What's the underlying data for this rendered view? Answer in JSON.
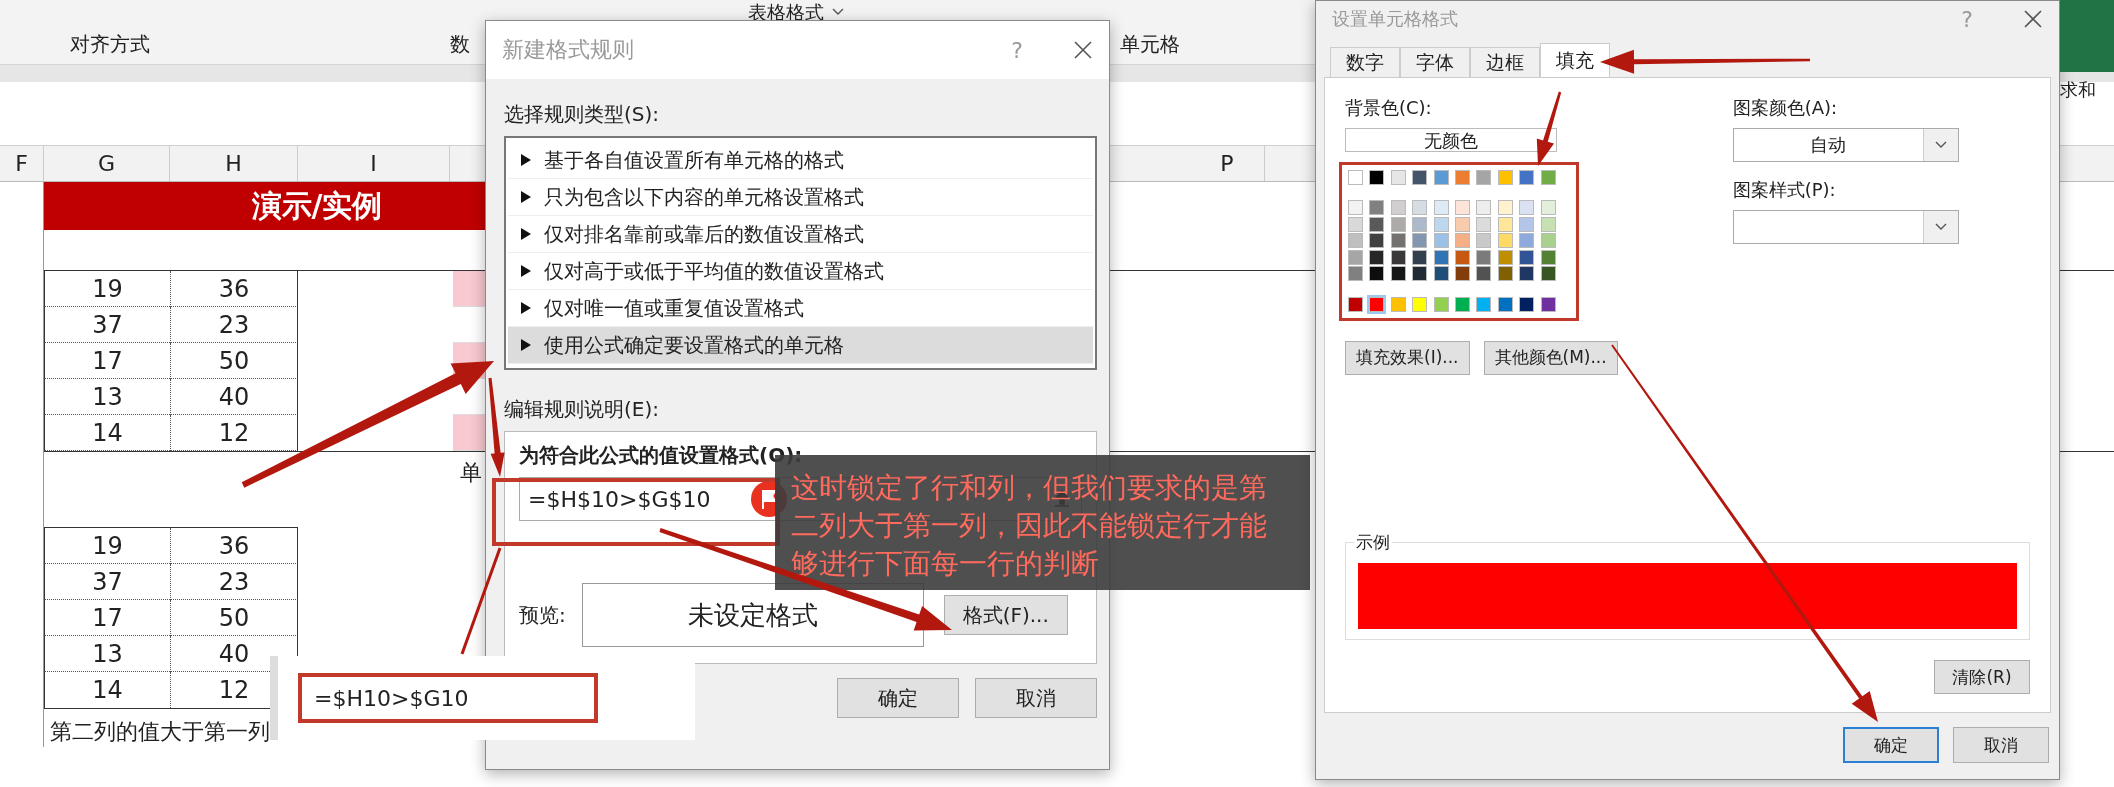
{
  "ribbon": {
    "top_items": [
      {
        "label": "表格格式"
      }
    ],
    "group_labels": [
      "对齐方式",
      "数",
      "单元格"
    ]
  },
  "sheet": {
    "columns": [
      "F",
      "G",
      "H",
      "I",
      "P"
    ],
    "banner": "演示/实例",
    "table_1": [
      {
        "g": "19",
        "h": "36",
        "highlighted": true
      },
      {
        "g": "37",
        "h": "23",
        "highlighted": false
      },
      {
        "g": "17",
        "h": "50",
        "highlighted": true
      },
      {
        "g": "13",
        "h": "40",
        "highlighted": false
      },
      {
        "g": "14",
        "h": "12",
        "highlighted": true
      }
    ],
    "side_text": "单",
    "table_2": [
      {
        "g": "19",
        "h": "36"
      },
      {
        "g": "37",
        "h": "23"
      },
      {
        "g": "17",
        "h": "50"
      },
      {
        "g": "13",
        "h": "40"
      },
      {
        "g": "14",
        "h": "12"
      }
    ],
    "caption": "第二列的值大于第一列"
  },
  "rule_dialog": {
    "title": "新建格式规则",
    "help": "?",
    "rule_type_label": "选择规则类型(S):",
    "rule_types": [
      {
        "label": "基于各自值设置所有单元格的格式",
        "selected": false
      },
      {
        "label": "只为包含以下内容的单元格设置格式",
        "selected": false
      },
      {
        "label": "仅对排名靠前或靠后的数值设置格式",
        "selected": false
      },
      {
        "label": "仅对高于或低于平均值的数值设置格式",
        "selected": false
      },
      {
        "label": "仅对唯一值或重复值设置格式",
        "selected": false
      },
      {
        "label": "使用公式确定要设置格式的单元格",
        "selected": true
      }
    ],
    "description_label": "编辑规则说明(E):",
    "formula_label": "为符合此公式的值设置格式(O):",
    "formula": "=$H$10>$G$10",
    "preview_label": "预览:",
    "preview": "未设定格式",
    "format_button": "格式(F)...",
    "buttons": [
      "确定",
      "取消"
    ]
  },
  "zoom_popup": {
    "formula": "=$H10>$G10"
  },
  "annotation": {
    "note": "这时锁定了行和列，但我们要求的是第二列大于第一列，因此不能锁定行才能够进行下面每一行的判断"
  },
  "format_dialog": {
    "title": "设置单元格格式",
    "help": "?",
    "tabs": [
      {
        "label": "数字",
        "selected": false
      },
      {
        "label": "字体",
        "selected": false
      },
      {
        "label": "边框",
        "selected": false
      },
      {
        "label": "填充",
        "selected": true
      }
    ],
    "background_label": "背景色(C):",
    "no_color": "无颜色",
    "palette": {
      "theme": [
        {
          "color": "#ffffff",
          "selected": false
        },
        {
          "color": "#000000",
          "selected": false
        },
        {
          "color": "#e7e6e6",
          "selected": false
        },
        {
          "color": "#44546a",
          "selected": false
        },
        {
          "color": "#5b9bd5",
          "selected": false
        },
        {
          "color": "#ed7d31",
          "selected": false
        },
        {
          "color": "#a5a5a5",
          "selected": false
        },
        {
          "color": "#ffc000",
          "selected": false
        },
        {
          "color": "#4472c4",
          "selected": false
        },
        {
          "color": "#70ad47",
          "selected": false
        }
      ],
      "tints": [
        [
          {
            "color": "#f2f2f2",
            "selected": false
          },
          {
            "color": "#808080",
            "selected": false
          },
          {
            "color": "#d0cece",
            "selected": false
          },
          {
            "color": "#d6dce4",
            "selected": false
          },
          {
            "color": "#ddebf7",
            "selected": false
          },
          {
            "color": "#fce4d6",
            "selected": false
          },
          {
            "color": "#ededed",
            "selected": false
          },
          {
            "color": "#fff2cc",
            "selected": false
          },
          {
            "color": "#d9e1f2",
            "selected": false
          },
          {
            "color": "#e2efda",
            "selected": false
          }
        ],
        [
          {
            "color": "#d9d9d9",
            "selected": false
          },
          {
            "color": "#595959",
            "selected": false
          },
          {
            "color": "#aeaaaa",
            "selected": false
          },
          {
            "color": "#acb9ca",
            "selected": false
          },
          {
            "color": "#bdd7ee",
            "selected": false
          },
          {
            "color": "#f8cbad",
            "selected": false
          },
          {
            "color": "#dbdbdb",
            "selected": false
          },
          {
            "color": "#ffe699",
            "selected": false
          },
          {
            "color": "#b4c6e7",
            "selected": false
          },
          {
            "color": "#c6e0b4",
            "selected": false
          }
        ],
        [
          {
            "color": "#bfbfbf",
            "selected": false
          },
          {
            "color": "#404040",
            "selected": false
          },
          {
            "color": "#757171",
            "selected": false
          },
          {
            "color": "#8497b0",
            "selected": false
          },
          {
            "color": "#9bc2e6",
            "selected": false
          },
          {
            "color": "#f4b084",
            "selected": false
          },
          {
            "color": "#c9c9c9",
            "selected": false
          },
          {
            "color": "#ffd966",
            "selected": false
          },
          {
            "color": "#8ea9db",
            "selected": false
          },
          {
            "color": "#a9d08e",
            "selected": false
          }
        ],
        [
          {
            "color": "#a6a6a6",
            "selected": false
          },
          {
            "color": "#262626",
            "selected": false
          },
          {
            "color": "#3a3838",
            "selected": false
          },
          {
            "color": "#333f4f",
            "selected": false
          },
          {
            "color": "#2f75b5",
            "selected": false
          },
          {
            "color": "#c65911",
            "selected": false
          },
          {
            "color": "#7b7b7b",
            "selected": false
          },
          {
            "color": "#bf8f00",
            "selected": false
          },
          {
            "color": "#305496",
            "selected": false
          },
          {
            "color": "#548235",
            "selected": false
          }
        ],
        [
          {
            "color": "#808080",
            "selected": false
          },
          {
            "color": "#0d0d0d",
            "selected": false
          },
          {
            "color": "#171616",
            "selected": false
          },
          {
            "color": "#222b35",
            "selected": false
          },
          {
            "color": "#1f4e78",
            "selected": false
          },
          {
            "color": "#833c0c",
            "selected": false
          },
          {
            "color": "#525252",
            "selected": false
          },
          {
            "color": "#806000",
            "selected": false
          },
          {
            "color": "#203764",
            "selected": false
          },
          {
            "color": "#375623",
            "selected": false
          }
        ]
      ],
      "standard": [
        {
          "color": "#c00000",
          "selected": false
        },
        {
          "color": "#ff0000",
          "selected": true
        },
        {
          "color": "#ffc000",
          "selected": false
        },
        {
          "color": "#ffff00",
          "selected": false
        },
        {
          "color": "#92d050",
          "selected": false
        },
        {
          "color": "#00b050",
          "selected": false
        },
        {
          "color": "#00b0f0",
          "selected": false
        },
        {
          "color": "#0070c0",
          "selected": false
        },
        {
          "color": "#002060",
          "selected": false
        },
        {
          "color": "#7030a0",
          "selected": false
        }
      ]
    },
    "fill_effects": "填充效果(I)...",
    "more_colors": "其他颜色(M)...",
    "pattern_color_label": "图案颜色(A):",
    "pattern_color": "自动",
    "pattern_style_label": "图案样式(P):",
    "sample_label": "示例",
    "clear": "清除(R)",
    "buttons": [
      {
        "label": "确定",
        "focused": true
      },
      {
        "label": "取消",
        "focused": false
      }
    ]
  },
  "excel_right": {
    "label": "求和"
  }
}
